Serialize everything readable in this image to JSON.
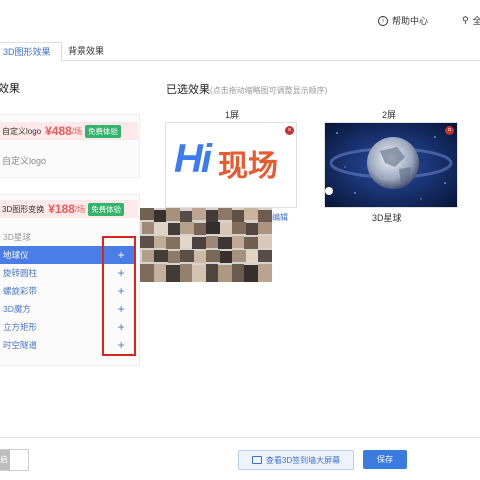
{
  "header": {
    "help_label": "帮助中心",
    "location_partial": "全"
  },
  "tabs": [
    {
      "label": "3D图形效果"
    },
    {
      "label": "背景效果"
    }
  ],
  "left": {
    "section_title": "效果",
    "card1": {
      "name": "自定义logo",
      "price": "¥488",
      "unit": "/场",
      "badge": "免费体验",
      "item": "自定义logo"
    },
    "card2": {
      "name": "3D图形变换",
      "price": "¥188",
      "unit": "/场",
      "badge": "免费体验",
      "items": [
        {
          "label": "3D星球"
        },
        {
          "label": "地球仪"
        },
        {
          "label": "旋转圆柱"
        },
        {
          "label": "螺旋彩带"
        },
        {
          "label": "3D魔方"
        },
        {
          "label": "立方矩形"
        },
        {
          "label": "时空隧道"
        }
      ]
    }
  },
  "right": {
    "section_title": "已选效果",
    "section_hint": "(点击拖动缩略图可调整显示顺序)",
    "screens": [
      {
        "label": "1屏",
        "logo_text_hi": "Hi",
        "logo_text_cn": "现场"
      },
      {
        "label": "2屏",
        "caption": "3D星球"
      }
    ],
    "edit_label": "编辑"
  },
  "footer": {
    "toggle_partial": "启",
    "preview_label": "查看3D签到墙大屏幕",
    "save_label": "保存"
  },
  "colors": {
    "accent": "#3b7be0",
    "price": "#f05a5a",
    "badge": "#33b36b",
    "highlight_box": "#d9261c"
  }
}
